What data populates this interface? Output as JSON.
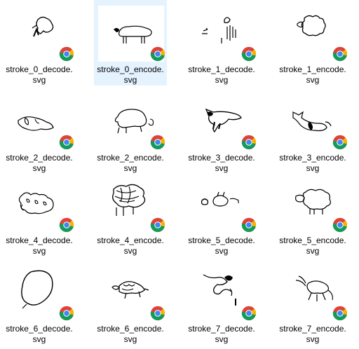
{
  "files": [
    {
      "name": "stroke_0_decode.",
      "ext": "svg",
      "sketch": "bird",
      "selected": false
    },
    {
      "name": "stroke_0_encode.",
      "ext": "svg",
      "sketch": "sheep-side",
      "selected": true
    },
    {
      "name": "stroke_1_decode.",
      "ext": "svg",
      "sketch": "scribble-lines",
      "selected": false
    },
    {
      "name": "stroke_1_encode.",
      "ext": "svg",
      "sketch": "fluffy-sheep",
      "selected": false
    },
    {
      "name": "stroke_2_decode.",
      "ext": "svg",
      "sketch": "loopy-animal",
      "selected": false
    },
    {
      "name": "stroke_2_encode.",
      "ext": "svg",
      "sketch": "pig-outline",
      "selected": false
    },
    {
      "name": "stroke_3_decode.",
      "ext": "svg",
      "sketch": "dark-beast",
      "selected": false
    },
    {
      "name": "stroke_3_encode.",
      "ext": "svg",
      "sketch": "dolphin-fish",
      "selected": false
    },
    {
      "name": "stroke_4_decode.",
      "ext": "svg",
      "sketch": "curly-sheep",
      "selected": false
    },
    {
      "name": "stroke_4_encode.",
      "ext": "svg",
      "sketch": "scribble-cloud",
      "selected": false
    },
    {
      "name": "stroke_5_decode.",
      "ext": "svg",
      "sketch": "small-creatures",
      "selected": false
    },
    {
      "name": "stroke_5_encode.",
      "ext": "svg",
      "sketch": "wool-sheep",
      "selected": false
    },
    {
      "name": "stroke_6_decode.",
      "ext": "svg",
      "sketch": "blob-circle",
      "selected": false
    },
    {
      "name": "stroke_6_encode.",
      "ext": "svg",
      "sketch": "turtle",
      "selected": false
    },
    {
      "name": "stroke_7_decode.",
      "ext": "svg",
      "sketch": "scorpion-squiggle",
      "selected": false
    },
    {
      "name": "stroke_7_encode.",
      "ext": "svg",
      "sketch": "lobster",
      "selected": false
    }
  ],
  "app_badge_icon": "chrome-icon",
  "colors": {
    "selection": "#e5f3ff",
    "text": "#000000",
    "stroke": "#000000"
  }
}
